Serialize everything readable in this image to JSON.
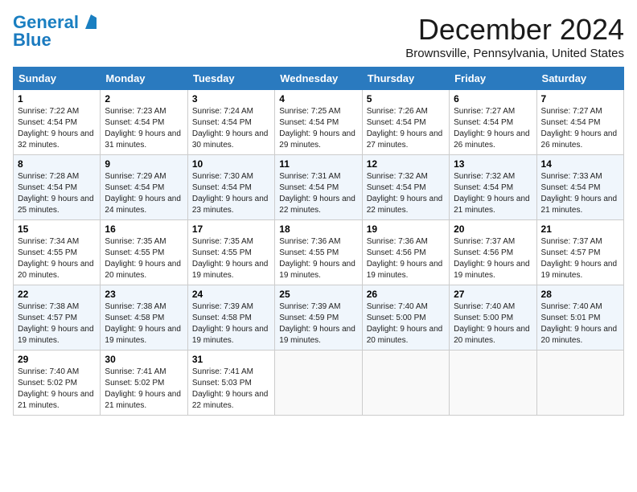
{
  "header": {
    "logo_line1": "General",
    "logo_line2": "Blue",
    "month_title": "December 2024",
    "location": "Brownsville, Pennsylvania, United States"
  },
  "weekdays": [
    "Sunday",
    "Monday",
    "Tuesday",
    "Wednesday",
    "Thursday",
    "Friday",
    "Saturday"
  ],
  "weeks": [
    [
      {
        "day": "1",
        "sunrise": "Sunrise: 7:22 AM",
        "sunset": "Sunset: 4:54 PM",
        "daylight": "Daylight: 9 hours and 32 minutes."
      },
      {
        "day": "2",
        "sunrise": "Sunrise: 7:23 AM",
        "sunset": "Sunset: 4:54 PM",
        "daylight": "Daylight: 9 hours and 31 minutes."
      },
      {
        "day": "3",
        "sunrise": "Sunrise: 7:24 AM",
        "sunset": "Sunset: 4:54 PM",
        "daylight": "Daylight: 9 hours and 30 minutes."
      },
      {
        "day": "4",
        "sunrise": "Sunrise: 7:25 AM",
        "sunset": "Sunset: 4:54 PM",
        "daylight": "Daylight: 9 hours and 29 minutes."
      },
      {
        "day": "5",
        "sunrise": "Sunrise: 7:26 AM",
        "sunset": "Sunset: 4:54 PM",
        "daylight": "Daylight: 9 hours and 27 minutes."
      },
      {
        "day": "6",
        "sunrise": "Sunrise: 7:27 AM",
        "sunset": "Sunset: 4:54 PM",
        "daylight": "Daylight: 9 hours and 26 minutes."
      },
      {
        "day": "7",
        "sunrise": "Sunrise: 7:27 AM",
        "sunset": "Sunset: 4:54 PM",
        "daylight": "Daylight: 9 hours and 26 minutes."
      }
    ],
    [
      {
        "day": "8",
        "sunrise": "Sunrise: 7:28 AM",
        "sunset": "Sunset: 4:54 PM",
        "daylight": "Daylight: 9 hours and 25 minutes."
      },
      {
        "day": "9",
        "sunrise": "Sunrise: 7:29 AM",
        "sunset": "Sunset: 4:54 PM",
        "daylight": "Daylight: 9 hours and 24 minutes."
      },
      {
        "day": "10",
        "sunrise": "Sunrise: 7:30 AM",
        "sunset": "Sunset: 4:54 PM",
        "daylight": "Daylight: 9 hours and 23 minutes."
      },
      {
        "day": "11",
        "sunrise": "Sunrise: 7:31 AM",
        "sunset": "Sunset: 4:54 PM",
        "daylight": "Daylight: 9 hours and 22 minutes."
      },
      {
        "day": "12",
        "sunrise": "Sunrise: 7:32 AM",
        "sunset": "Sunset: 4:54 PM",
        "daylight": "Daylight: 9 hours and 22 minutes."
      },
      {
        "day": "13",
        "sunrise": "Sunrise: 7:32 AM",
        "sunset": "Sunset: 4:54 PM",
        "daylight": "Daylight: 9 hours and 21 minutes."
      },
      {
        "day": "14",
        "sunrise": "Sunrise: 7:33 AM",
        "sunset": "Sunset: 4:54 PM",
        "daylight": "Daylight: 9 hours and 21 minutes."
      }
    ],
    [
      {
        "day": "15",
        "sunrise": "Sunrise: 7:34 AM",
        "sunset": "Sunset: 4:55 PM",
        "daylight": "Daylight: 9 hours and 20 minutes."
      },
      {
        "day": "16",
        "sunrise": "Sunrise: 7:35 AM",
        "sunset": "Sunset: 4:55 PM",
        "daylight": "Daylight: 9 hours and 20 minutes."
      },
      {
        "day": "17",
        "sunrise": "Sunrise: 7:35 AM",
        "sunset": "Sunset: 4:55 PM",
        "daylight": "Daylight: 9 hours and 19 minutes."
      },
      {
        "day": "18",
        "sunrise": "Sunrise: 7:36 AM",
        "sunset": "Sunset: 4:55 PM",
        "daylight": "Daylight: 9 hours and 19 minutes."
      },
      {
        "day": "19",
        "sunrise": "Sunrise: 7:36 AM",
        "sunset": "Sunset: 4:56 PM",
        "daylight": "Daylight: 9 hours and 19 minutes."
      },
      {
        "day": "20",
        "sunrise": "Sunrise: 7:37 AM",
        "sunset": "Sunset: 4:56 PM",
        "daylight": "Daylight: 9 hours and 19 minutes."
      },
      {
        "day": "21",
        "sunrise": "Sunrise: 7:37 AM",
        "sunset": "Sunset: 4:57 PM",
        "daylight": "Daylight: 9 hours and 19 minutes."
      }
    ],
    [
      {
        "day": "22",
        "sunrise": "Sunrise: 7:38 AM",
        "sunset": "Sunset: 4:57 PM",
        "daylight": "Daylight: 9 hours and 19 minutes."
      },
      {
        "day": "23",
        "sunrise": "Sunrise: 7:38 AM",
        "sunset": "Sunset: 4:58 PM",
        "daylight": "Daylight: 9 hours and 19 minutes."
      },
      {
        "day": "24",
        "sunrise": "Sunrise: 7:39 AM",
        "sunset": "Sunset: 4:58 PM",
        "daylight": "Daylight: 9 hours and 19 minutes."
      },
      {
        "day": "25",
        "sunrise": "Sunrise: 7:39 AM",
        "sunset": "Sunset: 4:59 PM",
        "daylight": "Daylight: 9 hours and 19 minutes."
      },
      {
        "day": "26",
        "sunrise": "Sunrise: 7:40 AM",
        "sunset": "Sunset: 5:00 PM",
        "daylight": "Daylight: 9 hours and 20 minutes."
      },
      {
        "day": "27",
        "sunrise": "Sunrise: 7:40 AM",
        "sunset": "Sunset: 5:00 PM",
        "daylight": "Daylight: 9 hours and 20 minutes."
      },
      {
        "day": "28",
        "sunrise": "Sunrise: 7:40 AM",
        "sunset": "Sunset: 5:01 PM",
        "daylight": "Daylight: 9 hours and 20 minutes."
      }
    ],
    [
      {
        "day": "29",
        "sunrise": "Sunrise: 7:40 AM",
        "sunset": "Sunset: 5:02 PM",
        "daylight": "Daylight: 9 hours and 21 minutes."
      },
      {
        "day": "30",
        "sunrise": "Sunrise: 7:41 AM",
        "sunset": "Sunset: 5:02 PM",
        "daylight": "Daylight: 9 hours and 21 minutes."
      },
      {
        "day": "31",
        "sunrise": "Sunrise: 7:41 AM",
        "sunset": "Sunset: 5:03 PM",
        "daylight": "Daylight: 9 hours and 22 minutes."
      },
      null,
      null,
      null,
      null
    ]
  ]
}
